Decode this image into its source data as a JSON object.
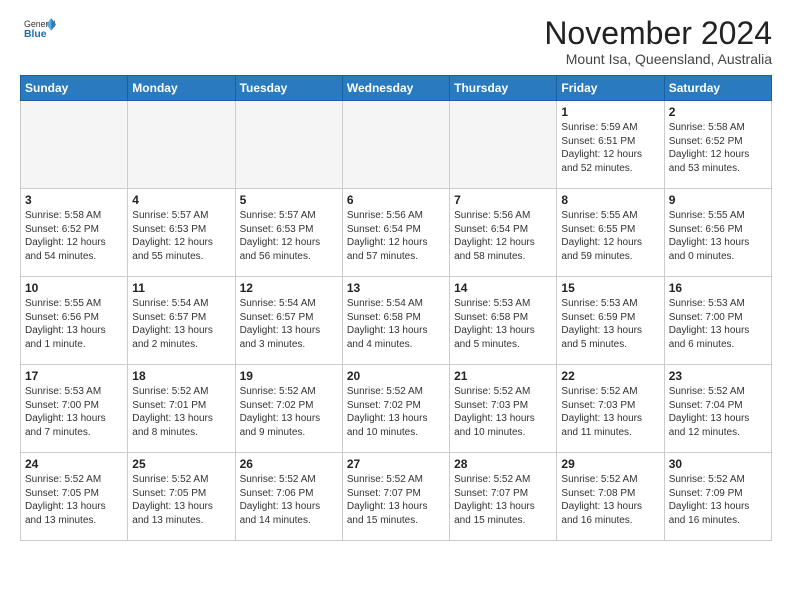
{
  "logo": {
    "line1": "General",
    "line2": "Blue"
  },
  "title": "November 2024",
  "subtitle": "Mount Isa, Queensland, Australia",
  "weekdays": [
    "Sunday",
    "Monday",
    "Tuesday",
    "Wednesday",
    "Thursday",
    "Friday",
    "Saturday"
  ],
  "weeks": [
    [
      {
        "day": "",
        "empty": true
      },
      {
        "day": "",
        "empty": true
      },
      {
        "day": "",
        "empty": true
      },
      {
        "day": "",
        "empty": true
      },
      {
        "day": "",
        "empty": true
      },
      {
        "day": "1",
        "sunrise": "5:59 AM",
        "sunset": "6:51 PM",
        "daylight": "12 hours and 52 minutes."
      },
      {
        "day": "2",
        "sunrise": "5:58 AM",
        "sunset": "6:52 PM",
        "daylight": "12 hours and 53 minutes."
      }
    ],
    [
      {
        "day": "3",
        "sunrise": "5:58 AM",
        "sunset": "6:52 PM",
        "daylight": "12 hours and 54 minutes."
      },
      {
        "day": "4",
        "sunrise": "5:57 AM",
        "sunset": "6:53 PM",
        "daylight": "12 hours and 55 minutes."
      },
      {
        "day": "5",
        "sunrise": "5:57 AM",
        "sunset": "6:53 PM",
        "daylight": "12 hours and 56 minutes."
      },
      {
        "day": "6",
        "sunrise": "5:56 AM",
        "sunset": "6:54 PM",
        "daylight": "12 hours and 57 minutes."
      },
      {
        "day": "7",
        "sunrise": "5:56 AM",
        "sunset": "6:54 PM",
        "daylight": "12 hours and 58 minutes."
      },
      {
        "day": "8",
        "sunrise": "5:55 AM",
        "sunset": "6:55 PM",
        "daylight": "12 hours and 59 minutes."
      },
      {
        "day": "9",
        "sunrise": "5:55 AM",
        "sunset": "6:56 PM",
        "daylight": "13 hours and 0 minutes."
      }
    ],
    [
      {
        "day": "10",
        "sunrise": "5:55 AM",
        "sunset": "6:56 PM",
        "daylight": "13 hours and 1 minute."
      },
      {
        "day": "11",
        "sunrise": "5:54 AM",
        "sunset": "6:57 PM",
        "daylight": "13 hours and 2 minutes."
      },
      {
        "day": "12",
        "sunrise": "5:54 AM",
        "sunset": "6:57 PM",
        "daylight": "13 hours and 3 minutes."
      },
      {
        "day": "13",
        "sunrise": "5:54 AM",
        "sunset": "6:58 PM",
        "daylight": "13 hours and 4 minutes."
      },
      {
        "day": "14",
        "sunrise": "5:53 AM",
        "sunset": "6:58 PM",
        "daylight": "13 hours and 5 minutes."
      },
      {
        "day": "15",
        "sunrise": "5:53 AM",
        "sunset": "6:59 PM",
        "daylight": "13 hours and 5 minutes."
      },
      {
        "day": "16",
        "sunrise": "5:53 AM",
        "sunset": "7:00 PM",
        "daylight": "13 hours and 6 minutes."
      }
    ],
    [
      {
        "day": "17",
        "sunrise": "5:53 AM",
        "sunset": "7:00 PM",
        "daylight": "13 hours and 7 minutes."
      },
      {
        "day": "18",
        "sunrise": "5:52 AM",
        "sunset": "7:01 PM",
        "daylight": "13 hours and 8 minutes."
      },
      {
        "day": "19",
        "sunrise": "5:52 AM",
        "sunset": "7:02 PM",
        "daylight": "13 hours and 9 minutes."
      },
      {
        "day": "20",
        "sunrise": "5:52 AM",
        "sunset": "7:02 PM",
        "daylight": "13 hours and 10 minutes."
      },
      {
        "day": "21",
        "sunrise": "5:52 AM",
        "sunset": "7:03 PM",
        "daylight": "13 hours and 10 minutes."
      },
      {
        "day": "22",
        "sunrise": "5:52 AM",
        "sunset": "7:03 PM",
        "daylight": "13 hours and 11 minutes."
      },
      {
        "day": "23",
        "sunrise": "5:52 AM",
        "sunset": "7:04 PM",
        "daylight": "13 hours and 12 minutes."
      }
    ],
    [
      {
        "day": "24",
        "sunrise": "5:52 AM",
        "sunset": "7:05 PM",
        "daylight": "13 hours and 13 minutes."
      },
      {
        "day": "25",
        "sunrise": "5:52 AM",
        "sunset": "7:05 PM",
        "daylight": "13 hours and 13 minutes."
      },
      {
        "day": "26",
        "sunrise": "5:52 AM",
        "sunset": "7:06 PM",
        "daylight": "13 hours and 14 minutes."
      },
      {
        "day": "27",
        "sunrise": "5:52 AM",
        "sunset": "7:07 PM",
        "daylight": "13 hours and 15 minutes."
      },
      {
        "day": "28",
        "sunrise": "5:52 AM",
        "sunset": "7:07 PM",
        "daylight": "13 hours and 15 minutes."
      },
      {
        "day": "29",
        "sunrise": "5:52 AM",
        "sunset": "7:08 PM",
        "daylight": "13 hours and 16 minutes."
      },
      {
        "day": "30",
        "sunrise": "5:52 AM",
        "sunset": "7:09 PM",
        "daylight": "13 hours and 16 minutes."
      }
    ]
  ]
}
